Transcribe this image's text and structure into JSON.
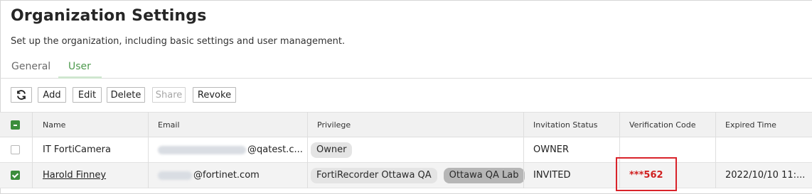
{
  "page": {
    "title": "Organization Settings",
    "subtitle": "Set up the organization, including basic settings and user management."
  },
  "tabs": [
    {
      "label": "General",
      "active": false
    },
    {
      "label": "User",
      "active": true
    }
  ],
  "toolbar": {
    "refresh_icon": "refresh-icon",
    "add": "Add",
    "edit": "Edit",
    "delete": "Delete",
    "share": "Share",
    "revoke": "Revoke"
  },
  "table": {
    "headers": [
      "Name",
      "Email",
      "Privilege",
      "Invitation Status",
      "Verification Code",
      "Expired Time"
    ],
    "rows": [
      {
        "selected": false,
        "name": "IT FortiCamera",
        "email_suffix": "@qatest.c...",
        "privileges": [
          "Owner"
        ],
        "status": "OWNER",
        "verification_code": "",
        "expired_time": ""
      },
      {
        "selected": true,
        "name": "Harold Finney",
        "email_suffix": "@fortinet.com",
        "privileges": [
          "FortiRecorder Ottawa QA",
          "Ottawa QA Lab"
        ],
        "status": "INVITED",
        "verification_code": "***562",
        "expired_time": "2022/10/10 11:..."
      }
    ]
  },
  "colors": {
    "accent": "#3c8d3c",
    "highlight": "#d9232a",
    "code_text": "#d01f1f"
  }
}
